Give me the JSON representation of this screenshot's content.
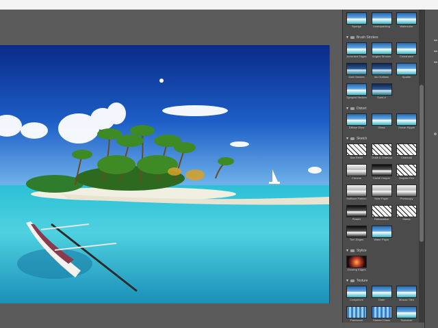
{
  "filters": [
    {
      "category": "",
      "items": [
        {
          "label": "Sponge",
          "icon": "filter-thumb-color"
        },
        {
          "label": "Underpainting",
          "icon": "filter-thumb-color"
        },
        {
          "label": "Watercolor",
          "icon": "filter-thumb-color"
        }
      ]
    },
    {
      "category": "Brush Strokes",
      "items": [
        {
          "label": "Accented Edges",
          "icon": "filter-thumb-color"
        },
        {
          "label": "Angled Strokes",
          "icon": "filter-thumb-color"
        },
        {
          "label": "Crosshatch",
          "icon": "filter-thumb-color"
        },
        {
          "label": "Dark Strokes",
          "icon": "filter-thumb-dark"
        },
        {
          "label": "Ink Outlines",
          "icon": "filter-thumb-dark"
        },
        {
          "label": "Spatter",
          "icon": "filter-thumb-color"
        },
        {
          "label": "Sprayed Strokes",
          "icon": "filter-thumb-color"
        },
        {
          "label": "Sumi-e",
          "icon": "filter-thumb-dark"
        }
      ]
    },
    {
      "category": "Distort",
      "items": [
        {
          "label": "Diffuse Glow",
          "icon": "filter-thumb-color"
        },
        {
          "label": "Glass",
          "icon": "filter-thumb-color"
        },
        {
          "label": "Ocean Ripple",
          "icon": "filter-thumb-color"
        }
      ]
    },
    {
      "category": "Sketch",
      "items": [
        {
          "label": "Bas Relief",
          "icon": "filter-thumb-sketch"
        },
        {
          "label": "Chalk & Charcoal",
          "icon": "filter-thumb-sketch"
        },
        {
          "label": "Charcoal",
          "icon": "filter-thumb-sketch"
        },
        {
          "label": "Chrome",
          "icon": "filter-thumb-sketch2"
        },
        {
          "label": "Conté Crayon",
          "icon": "filter-thumb-dark-sketch"
        },
        {
          "label": "Graphic Pen",
          "icon": "filter-thumb-sketch"
        },
        {
          "label": "Halftone Pattern",
          "icon": "filter-thumb-sketch2"
        },
        {
          "label": "Note Paper",
          "icon": "filter-thumb-sketch2"
        },
        {
          "label": "Photocopy",
          "icon": "filter-thumb-sketch2"
        },
        {
          "label": "Plaster",
          "icon": "filter-thumb-dark-sketch"
        },
        {
          "label": "Reticulation",
          "icon": "filter-thumb-sketch"
        },
        {
          "label": "Stamp",
          "icon": "filter-thumb-sketch"
        },
        {
          "label": "Torn Edges",
          "icon": "filter-thumb-dark-sketch"
        },
        {
          "label": "Water Paper",
          "icon": "filter-thumb-color"
        }
      ]
    },
    {
      "category": "Stylize",
      "items": [
        {
          "label": "Glowing Edges",
          "icon": "filter-thumb-glow"
        }
      ]
    },
    {
      "category": "Texture",
      "items": [
        {
          "label": "Craquelure",
          "icon": "filter-thumb-color"
        },
        {
          "label": "Grain",
          "icon": "filter-thumb-color"
        },
        {
          "label": "Mosaic Tiles",
          "icon": "filter-thumb-color"
        },
        {
          "label": "Patchwork",
          "icon": "filter-thumb-mosaic"
        },
        {
          "label": "Stained Glass",
          "icon": "filter-thumb-mosaic"
        },
        {
          "label": "Texturizer",
          "icon": "filter-thumb-color"
        }
      ]
    }
  ]
}
